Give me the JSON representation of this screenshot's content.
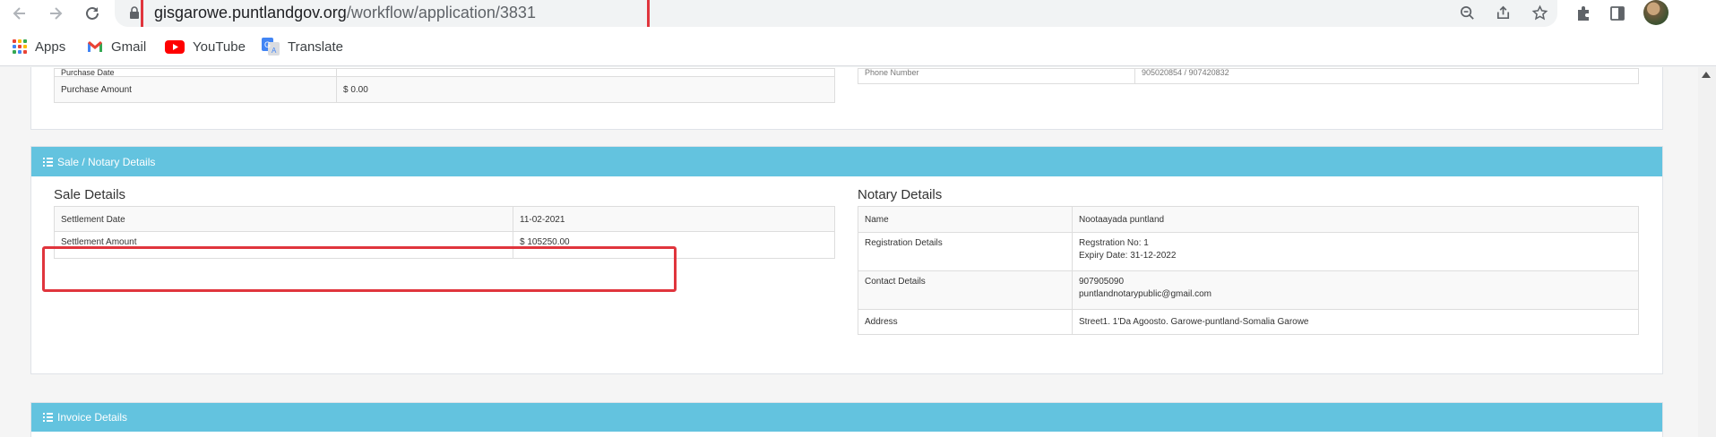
{
  "browser": {
    "url_host": "gisgarowe.puntlandgov.org",
    "url_path": "/workflow/application/3831",
    "bookmarks": [
      {
        "label": "Apps",
        "icon": "apps-grid-icon"
      },
      {
        "label": "Gmail",
        "icon": "gmail-icon"
      },
      {
        "label": "YouTube",
        "icon": "youtube-icon"
      },
      {
        "label": "Translate",
        "icon": "google-translate-icon"
      }
    ],
    "colors": {
      "highlight": "#e0353d",
      "panel_header": "#63c3df"
    }
  },
  "purchase": {
    "rows": [
      {
        "label": "Purchase Date",
        "value": ""
      },
      {
        "label": "Purchase Amount",
        "value": "$ 0.00"
      }
    ],
    "right_row": {
      "label": "Phone Number",
      "value": "905020854 / 907420832"
    }
  },
  "sale_notary": {
    "header": "Sale / Notary Details",
    "sale": {
      "title": "Sale Details",
      "rows": [
        {
          "label": "Settlement Date",
          "value": "11-02-2021"
        },
        {
          "label": "Settlement Amount",
          "value": "$ 105250.00"
        }
      ]
    },
    "notary": {
      "title": "Notary Details",
      "name": {
        "label": "Name",
        "value": "Nootaayada puntland"
      },
      "registration": {
        "label": "Registration Details",
        "line1": "Regstration No: 1",
        "line2": "Expiry Date: 31-12-2022"
      },
      "contact": {
        "label": "Contact Details",
        "line1": "907905090",
        "line2": "puntlandnotarypublic@gmail.com"
      },
      "address": {
        "label": "Address",
        "value": "Street1. 1'Da Agoosto. Garowe-puntland-Somalia Garowe"
      }
    }
  },
  "invoice": {
    "header": "Invoice Details"
  }
}
